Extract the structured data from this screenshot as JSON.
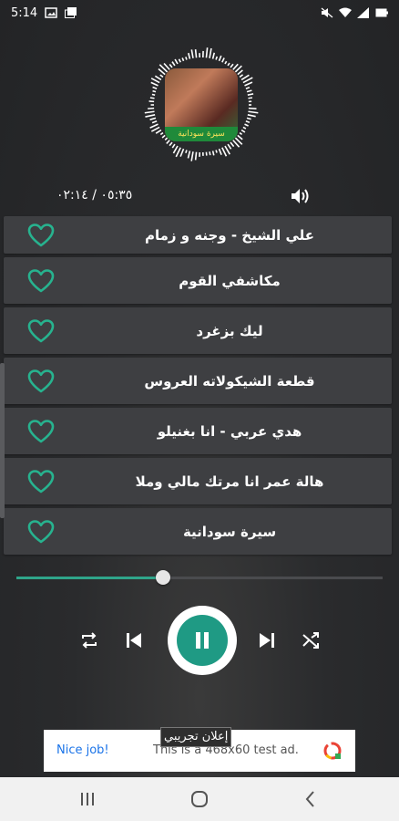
{
  "status_bar": {
    "time": "5:14",
    "icons": [
      "image-icon",
      "gallery-icon",
      "mute-icon",
      "wifi-icon",
      "signal-icon",
      "battery-icon"
    ]
  },
  "player": {
    "cover_caption": "سيرة سودانية",
    "time_display": "٠٥:٣٥ / ٠٢:١٤",
    "progress": 0.4,
    "colors": {
      "accent": "#1f9a84",
      "row_bg": "#3e3f42",
      "heart": "#27b38f"
    }
  },
  "playlist": [
    {
      "title": "علي الشيخ - وجنه و زمام"
    },
    {
      "title": "مكاشفي القوم"
    },
    {
      "title": "ليك بزغرد"
    },
    {
      "title": "قطعة الشيكولاته العروس"
    },
    {
      "title": "هدي عربي - انا بغنيلو"
    },
    {
      "title": "هالة عمر انا مرتك مالي وملا"
    },
    {
      "title": "سيرة سودانية"
    }
  ],
  "controls": [
    "repeat-icon",
    "previous-icon",
    "pause-icon",
    "next-icon",
    "shuffle-icon"
  ],
  "ad": {
    "label": "إعلان تجريبي",
    "nice_job": "Nice job!",
    "text": "This is a 468x60 test ad."
  },
  "navbar": [
    "recent-apps-icon",
    "home-icon",
    "back-icon"
  ]
}
